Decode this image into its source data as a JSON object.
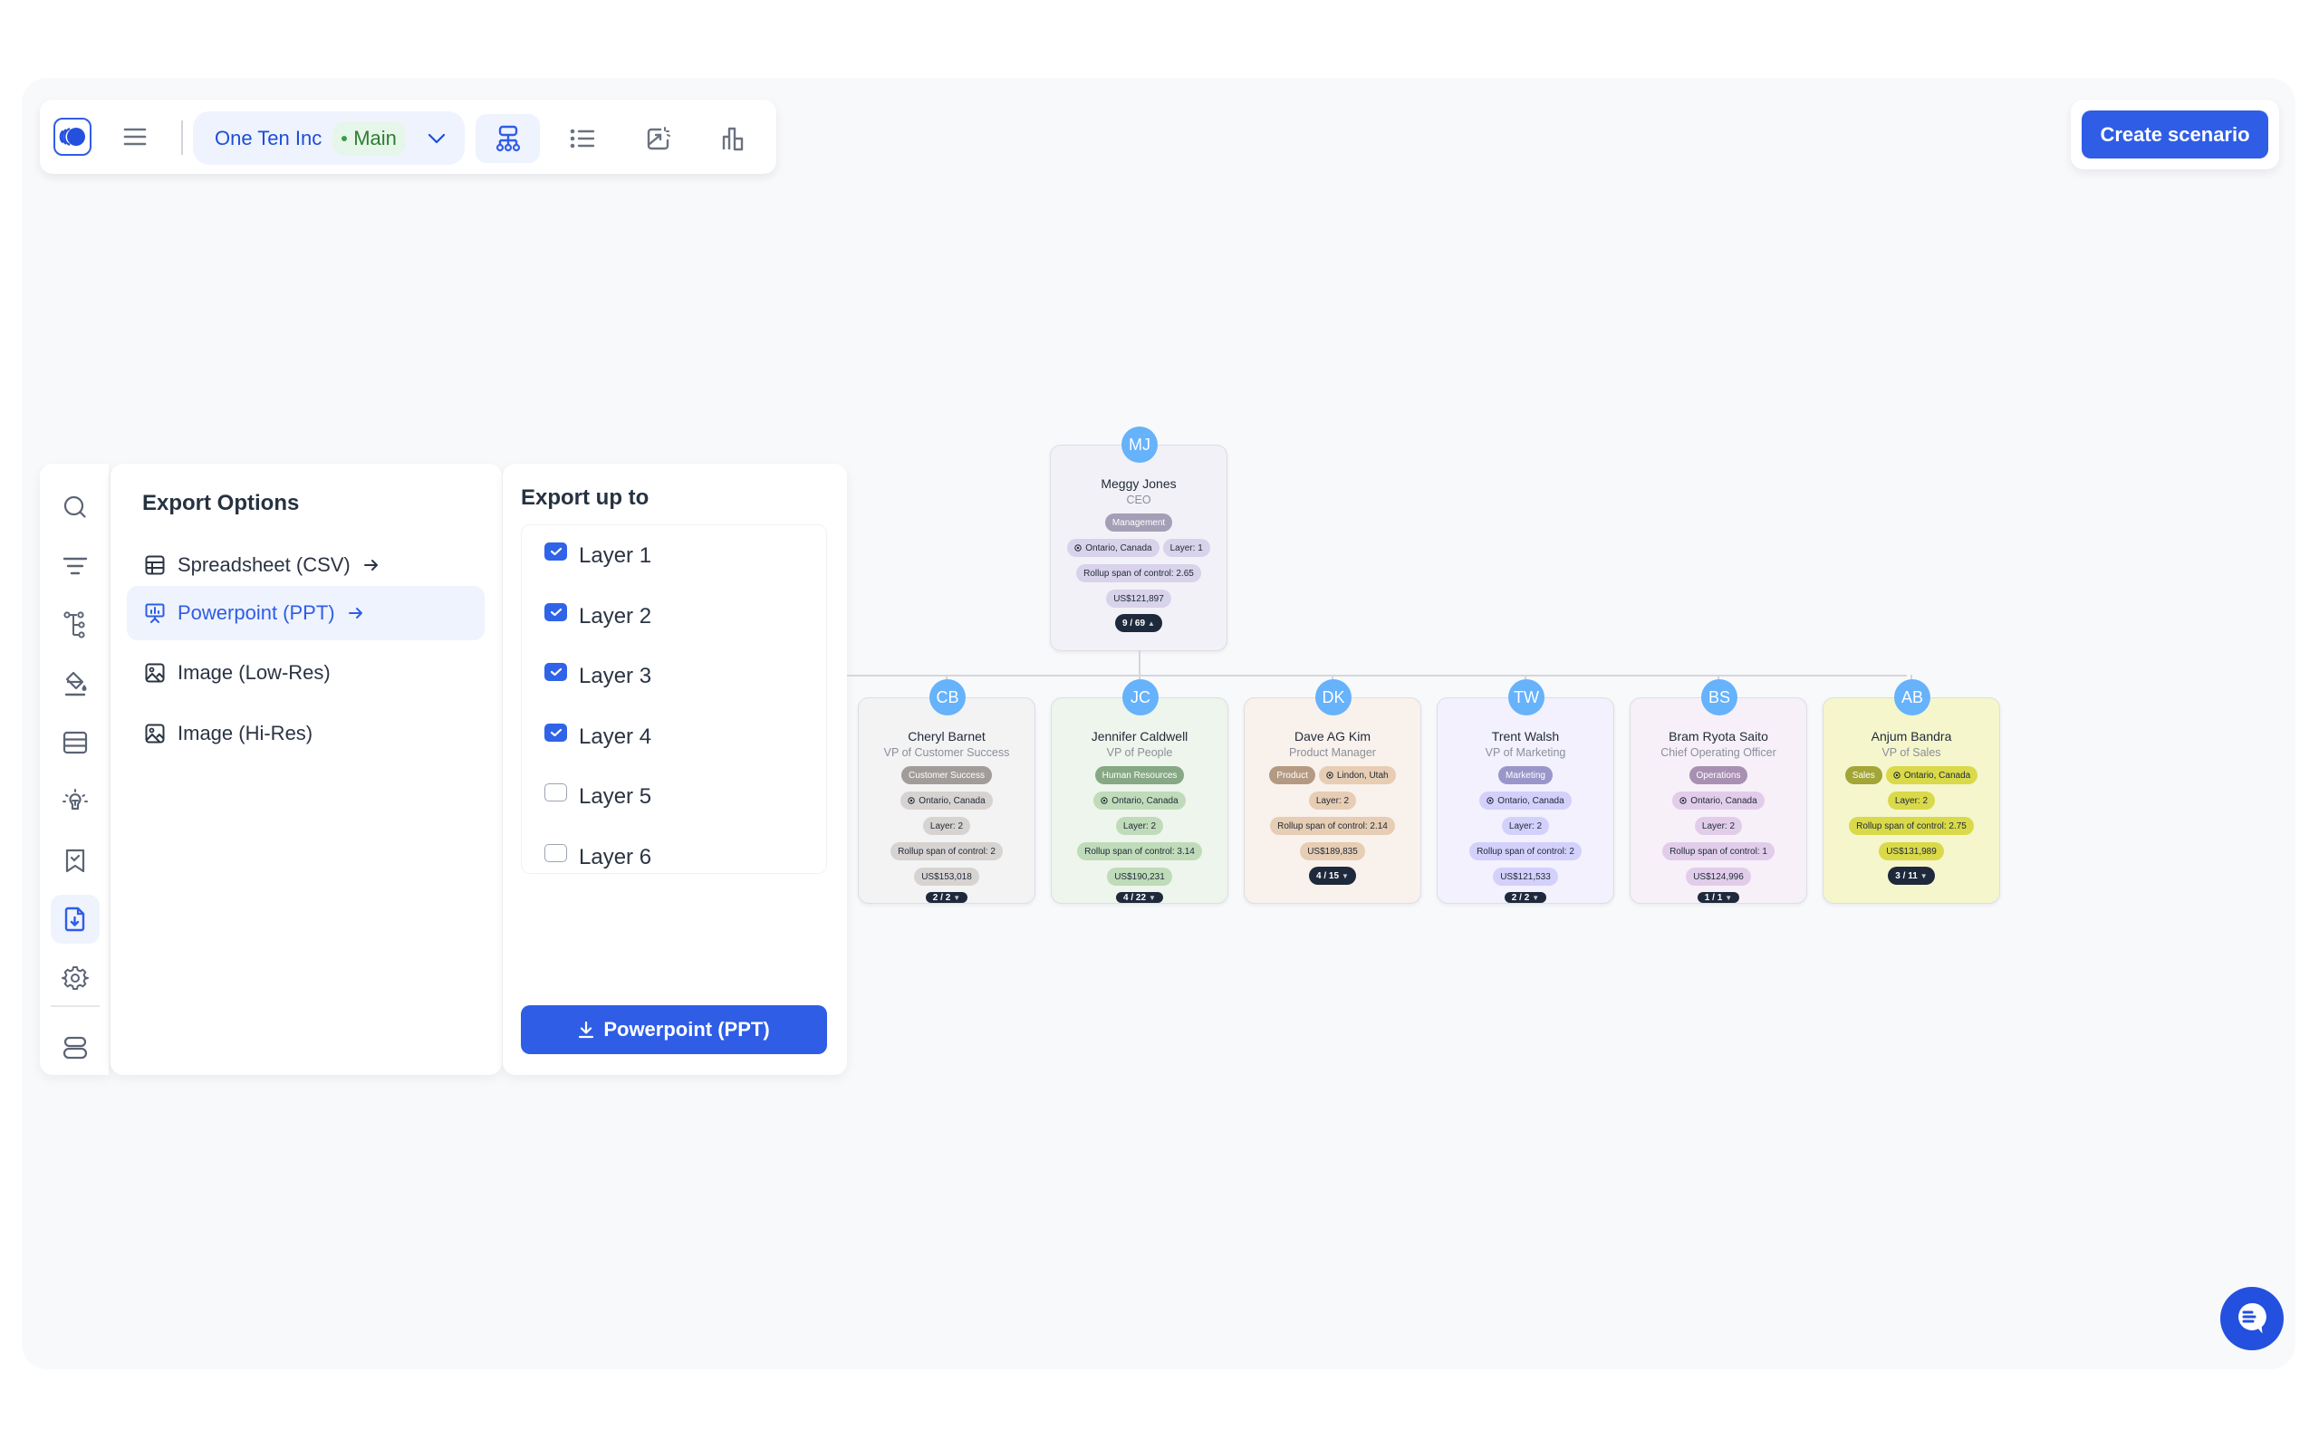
{
  "toolbar": {
    "company": "One Ten Inc",
    "branch": "Main",
    "views": [
      {
        "name": "org-chart-view",
        "active": true
      },
      {
        "name": "list-view",
        "active": false
      },
      {
        "name": "export-view",
        "active": false
      },
      {
        "name": "analytics-view",
        "active": false
      }
    ]
  },
  "create_scenario_label": "Create scenario",
  "rail": {
    "items": [
      "search-icon",
      "filter-icon",
      "hierarchy-icon",
      "paint-bucket-icon",
      "table-icon",
      "lightbulb-icon",
      "bookmark-check-icon",
      "file-download-icon",
      "gear-icon"
    ],
    "active": "file-download-icon",
    "bottom": "stack-icon"
  },
  "export_options": {
    "title": "Export Options",
    "items": [
      {
        "label": "Spreadsheet (CSV)",
        "icon": "table-icon",
        "arrow": true,
        "active": false
      },
      {
        "label": "Powerpoint (PPT)",
        "icon": "presentation-icon",
        "arrow": true,
        "active": true
      },
      {
        "label": "Image (Low-Res)",
        "icon": "image-icon",
        "arrow": false,
        "active": false
      },
      {
        "label": "Image (Hi-Res)",
        "icon": "image-icon",
        "arrow": false,
        "active": false
      }
    ]
  },
  "export_upto": {
    "title": "Export up to",
    "layers": [
      {
        "label": "Layer 1",
        "checked": true
      },
      {
        "label": "Layer 2",
        "checked": true
      },
      {
        "label": "Layer 3",
        "checked": true
      },
      {
        "label": "Layer 4",
        "checked": true
      },
      {
        "label": "Layer 5",
        "checked": false
      },
      {
        "label": "Layer 6",
        "checked": false
      }
    ],
    "button_label": "Powerpoint (PPT)"
  },
  "org": {
    "root": {
      "initials": "MJ",
      "name": "Meggy Jones",
      "title": "CEO",
      "dept": "Management",
      "location": "Ontario, Canada",
      "layer": "Layer: 1",
      "rollup": "Rollup span of control: 2.65",
      "salary": "US$121,897",
      "count": "9 / 69",
      "expanded": true,
      "colors": {
        "bg": "#f2f1f7",
        "dept": "#a49eb6",
        "pill": "#d8d2ea"
      }
    },
    "children": [
      {
        "initials": "CB",
        "name": "Cheryl Barnet",
        "title": "VP of Customer Success",
        "dept": "Customer Success",
        "location": "Ontario, Canada",
        "layer": "Layer: 2",
        "rollup": "Rollup span of control: 2",
        "salary": "US$153,018",
        "count": "2 / 2",
        "colors": {
          "bg": "#f3f3f4",
          "dept": "#a19c9a",
          "pill": "#d6d3d1"
        }
      },
      {
        "initials": "JC",
        "name": "Jennifer Caldwell",
        "title": "VP of People",
        "dept": "Human Resources",
        "location": "Ontario, Canada",
        "layer": "Layer: 2",
        "rollup": "Rollup span of control: 3.14",
        "salary": "US$190,231",
        "count": "4 / 22",
        "colors": {
          "bg": "#eef5ec",
          "dept": "#86a884",
          "pill": "#bfdbb9"
        }
      },
      {
        "initials": "DK",
        "name": "Dave AG Kim",
        "title": "Product Manager",
        "dept": "Product",
        "location": "Lindon, Utah",
        "layer": "Layer: 2",
        "rollup": "Rollup span of control: 2.14",
        "salary": "US$189,835",
        "count": "4 / 15",
        "colors": {
          "bg": "#f9f1ec",
          "dept": "#b49a82",
          "pill": "#e6cdb3"
        }
      },
      {
        "initials": "TW",
        "name": "Trent Walsh",
        "title": "VP of Marketing",
        "dept": "Marketing",
        "location": "Ontario, Canada",
        "layer": "Layer: 2",
        "rollup": "Rollup span of control: 2",
        "salary": "US$121,533",
        "count": "2 / 2",
        "colors": {
          "bg": "#f2f1fd",
          "dept": "#9b96c9",
          "pill": "#d3d0fb"
        }
      },
      {
        "initials": "BS",
        "name": "Bram Ryota Saito",
        "title": "Chief Operating Officer",
        "dept": "Operations",
        "location": "Ontario, Canada",
        "layer": "Layer: 2",
        "rollup": "Rollup span of control: 1",
        "salary": "US$124,996",
        "count": "1 / 1",
        "colors": {
          "bg": "#f7f0f8",
          "dept": "#a890b2",
          "pill": "#e1cdea"
        }
      },
      {
        "initials": "AB",
        "name": "Anjum Bandra",
        "title": "VP of Sales",
        "dept": "Sales",
        "location": "Ontario, Canada",
        "layer": "Layer: 2",
        "rollup": "Rollup span of control: 2.75",
        "salary": "US$131,989",
        "count": "3 / 11",
        "colors": {
          "bg": "#f5f6cc",
          "dept": "#a3a536",
          "pill": "#d9d94a"
        }
      }
    ]
  },
  "chat_icon": "chat-bubble-icon"
}
